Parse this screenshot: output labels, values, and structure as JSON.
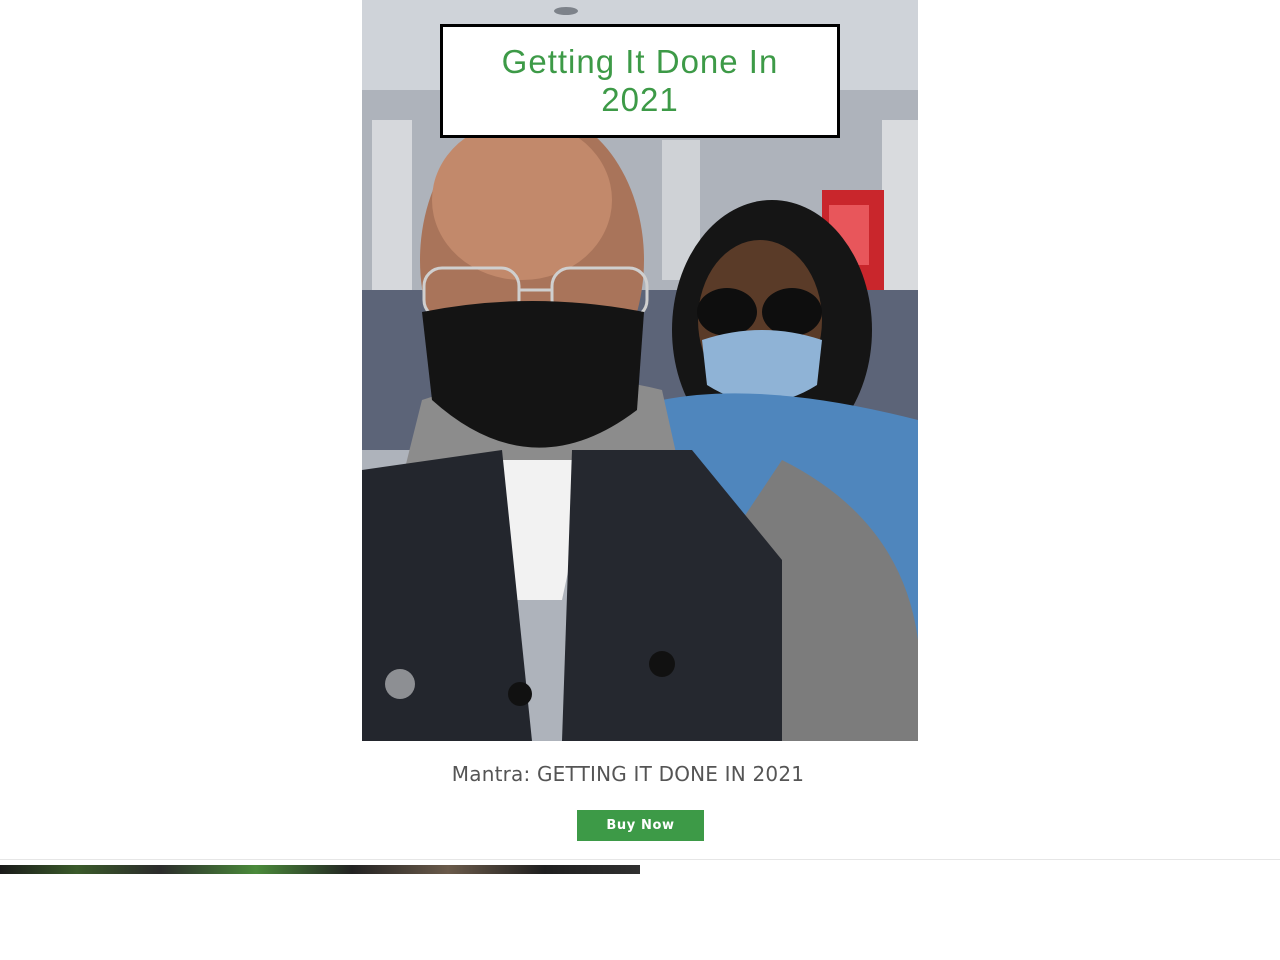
{
  "hero": {
    "title": "Getting It Done In 2021",
    "photo_icon": "selfie-photo"
  },
  "caption": "Mantra: GETTING IT DONE IN 2021",
  "buy_button": "Buy Now",
  "colors": {
    "accent": "#3d9a47",
    "caption_text": "#555555",
    "title_border": "#000000"
  }
}
